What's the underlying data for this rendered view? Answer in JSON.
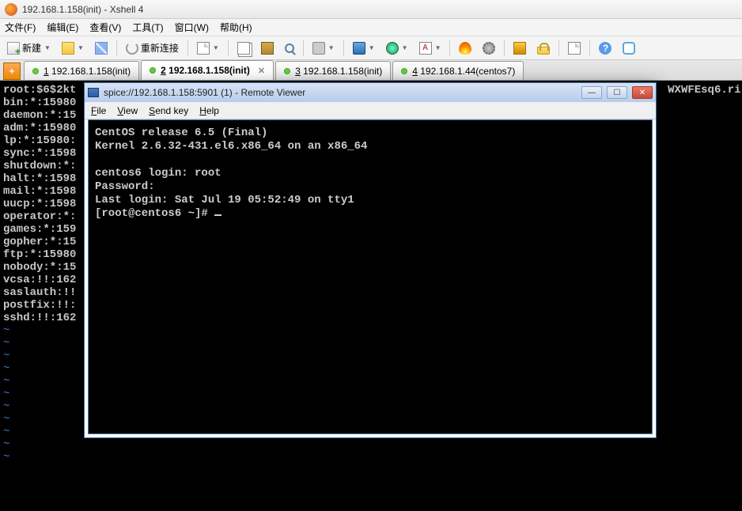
{
  "window": {
    "title": "192.168.1.158(init) - Xshell 4"
  },
  "menu": {
    "file": "文件(F)",
    "edit": "编辑(E)",
    "view": "查看(V)",
    "tools": "工具(T)",
    "window": "窗口(W)",
    "help": "帮助(H)"
  },
  "toolbar": {
    "new_label": "新建",
    "reconnect_label": "重新连接"
  },
  "tabs": [
    {
      "num": "1",
      "label": "192.168.1.158(init)"
    },
    {
      "num": "2",
      "label": "192.168.1.158(init)"
    },
    {
      "num": "3",
      "label": "192.168.1.158(init)"
    },
    {
      "num": "4",
      "label": "192.168.1.44(centos7)"
    }
  ],
  "bg_terminal": {
    "l1": "root:$6$2kt                                                                                         WXWFEsq6.ri",
    "l2": "bin:*:15980",
    "l3": "daemon:*:15",
    "l4": "adm:*:15980",
    "l5": "lp:*:15980:",
    "l6": "sync:*:1598",
    "l7": "shutdown:*:",
    "l8": "halt:*:1598",
    "l9": "mail:*:1598",
    "l10": "uucp:*:1598",
    "l11": "operator:*:",
    "l12": "games:*:159",
    "l13": "gopher:*:15",
    "l14": "ftp:*:15980",
    "l15": "nobody:*:15",
    "l16": "vcsa:!!:162",
    "l17": "saslauth:!!",
    "l18": "postfix:!!:",
    "l19": "sshd:!!:162",
    "tilde": "~"
  },
  "rviewer": {
    "title": "spice://192.168.1.158:5901 (1) - Remote Viewer",
    "menu": {
      "file_u": "F",
      "file": "ile",
      "view_u": "V",
      "view": "iew",
      "send_u": "S",
      "send": "end key",
      "help_u": "H",
      "help": "elp"
    },
    "term": {
      "l1": "CentOS release 6.5 (Final)",
      "l2": "Kernel 2.6.32-431.el6.x86_64 on an x86_64",
      "l3": "",
      "l4": "centos6 login: root",
      "l5": "Password:",
      "l6": "Last login: Sat Jul 19 05:52:49 on tty1",
      "l7": "[root@centos6 ~]# "
    }
  }
}
